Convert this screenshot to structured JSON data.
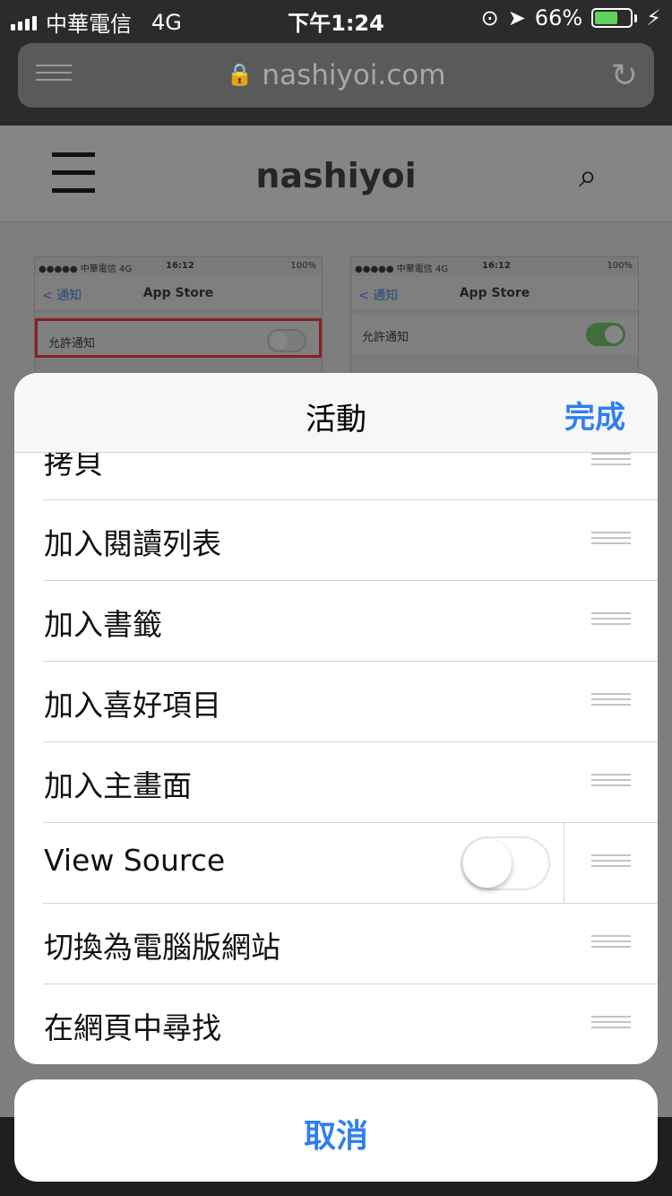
{
  "status_bar": {
    "carrier": "中華電信",
    "network": "4G",
    "time": "下午1:24",
    "battery_percent": "66%",
    "battery_level": 0.66
  },
  "browser": {
    "url": "nashiyoi.com",
    "icons": [
      "reader-icon",
      "lock-icon",
      "reload-icon"
    ]
  },
  "site": {
    "title": "nashiyoi",
    "thumbnails": [
      {
        "carrier": "●●●●● 中華電信  4G",
        "time": "16:12",
        "battery": "100%",
        "back": "通知",
        "title": "App Store",
        "row_label": "允許通知",
        "switch_on": false
      },
      {
        "carrier": "●●●●● 中華電信  4G",
        "time": "16:12",
        "battery": "100%",
        "back": "通知",
        "title": "App Store",
        "row_label": "允許通知",
        "switch_on": true
      }
    ]
  },
  "sheet": {
    "title": "活動",
    "done": "完成",
    "items": [
      {
        "label": "拷貝"
      },
      {
        "label": "加入閱讀列表"
      },
      {
        "label": "加入書籤"
      },
      {
        "label": "加入喜好項目"
      },
      {
        "label": "加入主畫面"
      },
      {
        "label": "View Source",
        "toggle_on": false
      },
      {
        "label": "切換為電腦版網站"
      },
      {
        "label": "在網頁中尋找"
      }
    ],
    "cancel": "取消"
  },
  "colors": {
    "accent": "#2f7ff0",
    "battery_fill": "#5fd35a",
    "toggle_on": "#4cd964"
  }
}
